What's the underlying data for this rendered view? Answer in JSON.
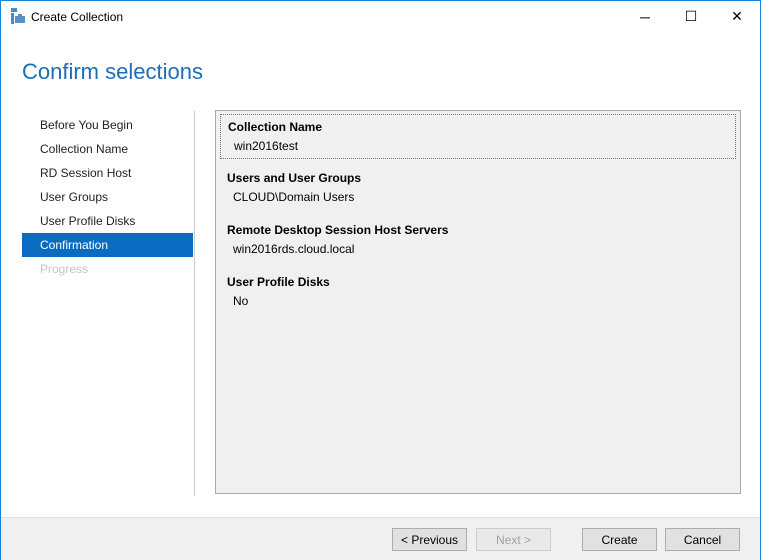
{
  "window": {
    "title": "Create Collection",
    "minimize": "─",
    "maximize": "☐",
    "close": "✕"
  },
  "heading": "Confirm selections",
  "nav": [
    {
      "label": "Before You Begin",
      "state": "normal"
    },
    {
      "label": "Collection Name",
      "state": "normal"
    },
    {
      "label": "RD Session Host",
      "state": "normal"
    },
    {
      "label": "User Groups",
      "state": "normal"
    },
    {
      "label": "User Profile Disks",
      "state": "normal"
    },
    {
      "label": "Confirmation",
      "state": "active"
    },
    {
      "label": "Progress",
      "state": "disabled"
    }
  ],
  "sections": [
    {
      "label": "Collection Name",
      "value": "win2016test"
    },
    {
      "label": "Users and User Groups",
      "value": "CLOUD\\Domain Users"
    },
    {
      "label": "Remote Desktop Session Host Servers",
      "value": "win2016rds.cloud.local"
    },
    {
      "label": "User Profile Disks",
      "value": "No"
    }
  ],
  "buttons": {
    "previous": "< Previous",
    "next": "Next >",
    "create": "Create",
    "cancel": "Cancel"
  }
}
